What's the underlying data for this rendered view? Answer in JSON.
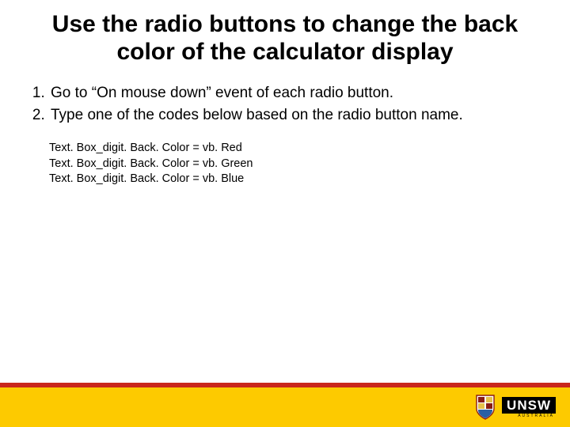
{
  "title": "Use the radio buttons to change the back color of the calculator display",
  "steps": [
    "Go to “On mouse down” event of each radio button.",
    "Type one of the codes below based on the radio button name."
  ],
  "code_lines": [
    "Text. Box_digit. Back. Color = vb. Red",
    "Text. Box_digit. Back. Color = vb. Green",
    "Text. Box_digit. Back. Color = vb. Blue"
  ],
  "footer": {
    "brand": "UNSW",
    "brand_sub": "AUSTRALIA"
  },
  "colors": {
    "red_bar": "#c9261b",
    "yellow_bar": "#fdca00"
  }
}
